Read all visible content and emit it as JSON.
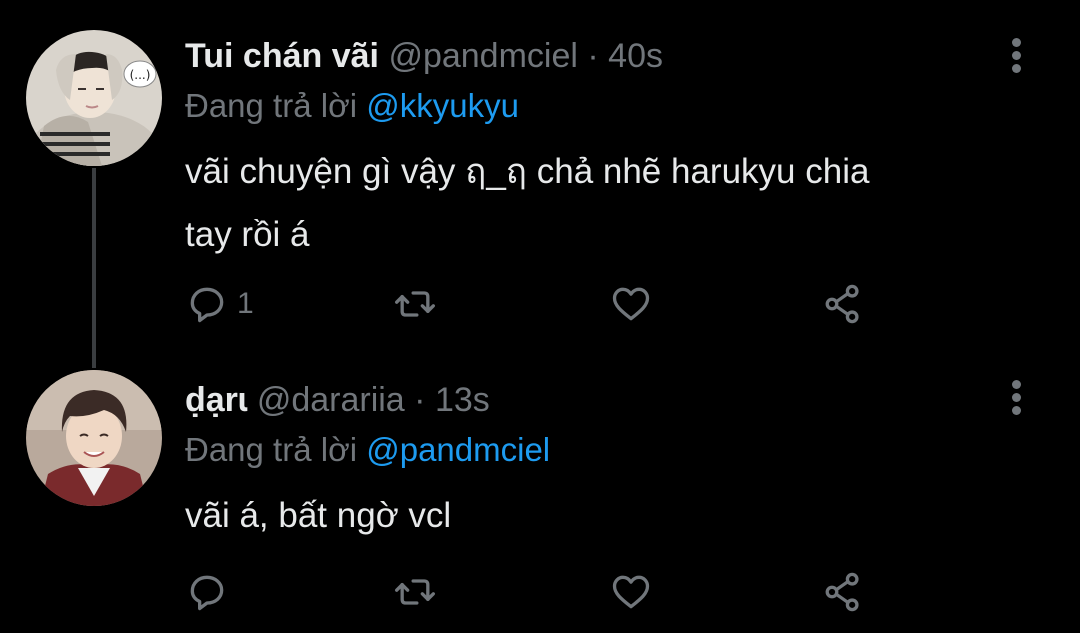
{
  "tweets": [
    {
      "display_name": "Tui chán vãi",
      "handle": "@pandmciel",
      "separator": "·",
      "time": "40s",
      "reply_prefix": "Đang trả lời",
      "reply_to": "@kkyukyu",
      "text_line1": "vãi chuyện gì vậy ฤ_ฤ chả nhẽ harukyu chia",
      "text_line2": "tay rồi á",
      "reply_count": "1",
      "avatar_bubble": "(...)",
      "icons": [
        "reply-icon",
        "retweet-icon",
        "like-icon",
        "share-icon",
        "more-icon"
      ]
    },
    {
      "display_name": "ḍạrɩ",
      "handle": "@darariia",
      "separator": "·",
      "time": "13s",
      "reply_prefix": "Đang trả lời",
      "reply_to": "@pandmciel",
      "text_line1": "vãi á, bất ngờ vcl",
      "reply_count": "",
      "icons": [
        "reply-icon",
        "retweet-icon",
        "like-icon",
        "share-icon",
        "more-icon"
      ]
    }
  ],
  "colors": {
    "background": "#000000",
    "text": "#e7e9ea",
    "secondary": "#71767b",
    "link": "#1d9bf0",
    "thread_line": "#3a3d40"
  }
}
